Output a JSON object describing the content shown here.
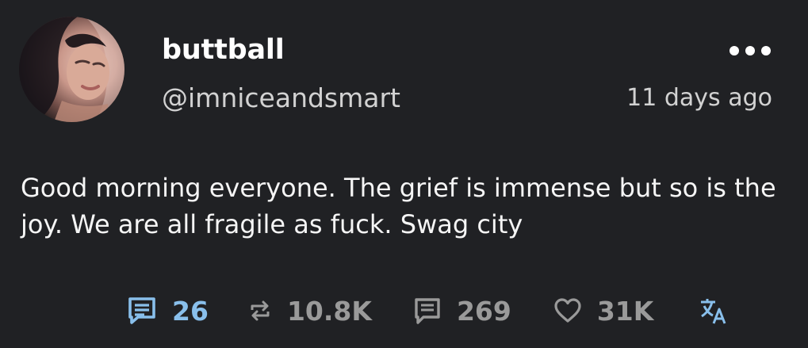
{
  "post": {
    "display_name": "buttball",
    "handle": "@imniceandsmart",
    "time_ago": "11 days ago",
    "text": "Good morning everyone. The grief is immense but so is the joy. We are all fragile as fuck. Swag city"
  },
  "stats": {
    "comments": "26",
    "reposts": "10.8K",
    "quotes": "269",
    "likes": "31K"
  },
  "icons": {
    "avatar": "profile-photo",
    "more": "more-dots-icon",
    "comments": "comments-icon",
    "reposts": "repost-icon",
    "quotes": "quote-icon",
    "likes": "heart-icon",
    "translate": "translate-icon"
  },
  "colors": {
    "background": "#202124",
    "text": "#ffffff",
    "secondary_text": "#d2d2d2",
    "muted": "#9a9a9a",
    "accent": "#89bfeb"
  }
}
